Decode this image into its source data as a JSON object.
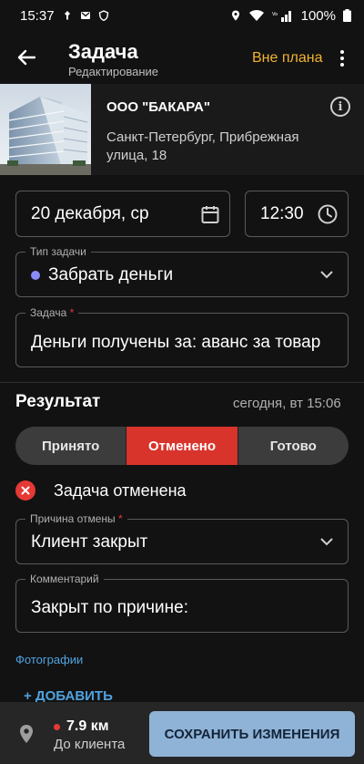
{
  "status_bar": {
    "time": "15:37",
    "battery": "100%"
  },
  "header": {
    "title": "Задача",
    "subtitle": "Редактирование",
    "badge": "Вне плана"
  },
  "client": {
    "name": "ООО \"БАКАРА\"",
    "address": "Санкт-Петербург,  Прибрежная улица, 18"
  },
  "task": {
    "date": "20 декабря, ср",
    "time": "12:30",
    "type_label": "Тип задачи",
    "type_value": "Забрать деньги",
    "type_dot_color": "#8a8cf5",
    "task_label": "Задача",
    "task_value": "Деньги получены за: аванс за товар"
  },
  "result": {
    "title": "Результат",
    "time": "сегодня, вт 15:06",
    "segments": [
      "Принято",
      "Отменено",
      "Готово"
    ],
    "active_segment": "Отменено",
    "status_text": "Задача отменена",
    "reason_label": "Причина отмены",
    "reason_value": "Клиент закрыт",
    "comment_label": "Комментарий",
    "comment_value": "Закрыт по причине:",
    "photos_label": "Фотографии",
    "add_label": "+ ДОБАВИТЬ"
  },
  "bottom": {
    "distance": "7.9 км",
    "distance_label": "До клиента",
    "save_label": "СОХРАНИТЬ ИЗМЕНЕНИЯ"
  },
  "colors": {
    "accent_orange": "#f2b233",
    "danger": "#e53935",
    "link": "#4fa3e0",
    "save_button": "#8fb3d6"
  }
}
